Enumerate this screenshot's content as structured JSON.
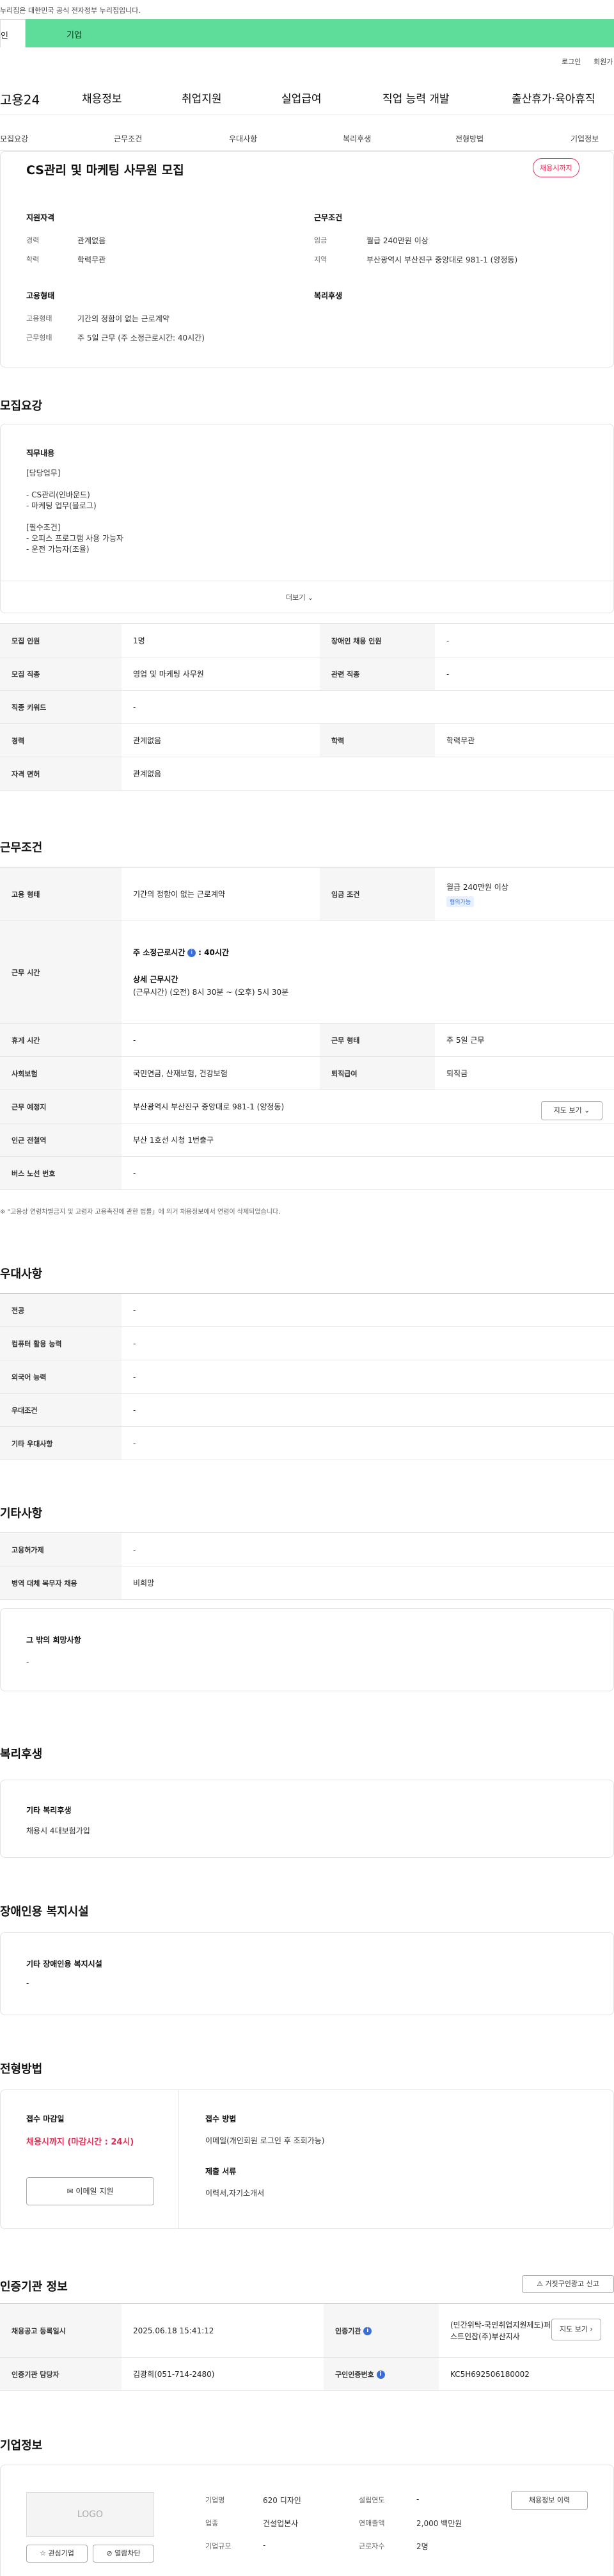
{
  "gov_banner": "누리집은 대한민국 공식 전자정부 누리집입니다.",
  "user_tabs": [
    "인",
    "기업"
  ],
  "top_links": [
    "로그인",
    "회원가"
  ],
  "nav": {
    "logo": "고용24",
    "items": [
      "채용정보",
      "취업지원",
      "실업급여",
      "직업 능력 개발",
      "출산휴가·육아휴직"
    ]
  },
  "subnav": [
    "모집요강",
    "근무조건",
    "우대사항",
    "복리후생",
    "전형방법",
    "기업정보"
  ],
  "summary": {
    "title": "CS관리 및 마케팅 사무원 모집",
    "status": "채용시까지",
    "qual_head": "지원자격",
    "career_l": "경력",
    "career_v": "관계없음",
    "edu_l": "학력",
    "edu_v": "학력무관",
    "cond_head": "근무조건",
    "wage_l": "임금",
    "wage_v": "월급 240만원 이상",
    "loc_l": "지역",
    "loc_v": "부산광역시 부산진구 중앙대로 981-1 (양정동)",
    "emp_head": "고용형태",
    "emp_type_l": "고용형태",
    "emp_type_v": "기간의 정함이 없는 근로계약",
    "work_l": "근무형태",
    "work_v": "주 5일 근무 (주 소정근로시간: 40시간)",
    "welfare_head": "복리후생"
  },
  "recruit": {
    "heading": "모집요강",
    "duty_head": "직무내용",
    "duty_lines": [
      "[담당업무]",
      "",
      "- CS관리(인바운드)",
      "- 마케팅 업무(블로그)",
      "",
      "[필수조건]",
      "- 오피스 프로그램 사용 가능자",
      "- 운전 가능자(조율)"
    ],
    "more": "더보기",
    "rows": [
      [
        "모집 인원",
        "1명",
        "장애인 채용 인원",
        "-"
      ],
      [
        "모집 직종",
        "영업 및 마케팅 사무원",
        "관련 직종",
        "-"
      ],
      [
        "직종 키워드",
        "-"
      ],
      [
        "경력",
        "관계없음",
        "학력",
        "학력무관"
      ],
      [
        "자격 면허",
        "관계없음"
      ]
    ]
  },
  "conditions": {
    "heading": "근무조건",
    "emp_l": "고용 형태",
    "emp_v": "기간의 정함이 없는 근로계약",
    "wage_l": "임금 조건",
    "wage_v": "월급 240만원 이상",
    "wage_badge": "협의가능",
    "hours_l": "근무 시간",
    "hours_a": "주 소정근로시간",
    "hours_b": ": 40시간",
    "hours_detail_h": "상세 근무시간",
    "hours_detail": "(근무시간) (오전) 8시 30분 ~ (오후) 5시 30분",
    "rest_l": "휴게 시간",
    "rest_v": "-",
    "form_l": "근무 형태",
    "form_v": "주 5일 근무",
    "ins_l": "사회보험",
    "ins_v": "국민연금, 산재보험, 건강보험",
    "ret_l": "퇴직급여",
    "ret_v": "퇴직금",
    "place_l": "근무 예정지",
    "place_v": "부산광역시 부산진구 중앙대로 981-1 (양정동)",
    "map_btn": "지도 보기",
    "subway_l": "인근 전철역",
    "subway_v": "부산 1호선 시청 1번출구",
    "bus_l": "버스 노선 번호",
    "bus_v": "-",
    "note": "\"고용상 연령차별금지 및 고령자 고용촉진에 관한 법률」에 의거 채용정보에서 연령이 삭제되었습니다."
  },
  "pref": {
    "heading": "우대사항",
    "rows": [
      [
        "전공",
        "-"
      ],
      [
        "컴퓨터 활용 능력",
        "-"
      ],
      [
        "외국어 능력",
        "-"
      ],
      [
        "우대조건",
        "-"
      ],
      [
        "기타 우대사항",
        "-"
      ]
    ]
  },
  "etc": {
    "heading": "기타사항",
    "rows": [
      [
        "고용허가제",
        "-"
      ],
      [
        "병역 대체 복무자 채용",
        "비희망"
      ]
    ],
    "other_head": "그 밖의 희망사항",
    "other_v": "-"
  },
  "welfare": {
    "heading": "복리후생",
    "head": "기타 복리후생",
    "value": "채용시 4대보험가입"
  },
  "disabled": {
    "heading": "장애인용 복지시설",
    "head": "기타 장애인용 복지시설",
    "value": "-"
  },
  "process": {
    "heading": "전형방법",
    "deadline_l": "접수 마감일",
    "deadline_v": "채용시까지 (마감시간 : 24시)",
    "method_l": "접수 방법",
    "method_v": "이메일(개인회원 로그인 후 조회가능)",
    "docs_l": "제출 서류",
    "docs_v": "이력서,자기소개서",
    "email_btn": "이메일 지원"
  },
  "agency": {
    "heading": "인증기관 정보",
    "report_btn": "거짓구인광고 신고",
    "reg_l": "채용공고 등록일시",
    "reg_v": "2025.06.18 15:41:12",
    "org_l": "인증기관",
    "org_v": "(민간위탁-국민취업지원제도)퍼스트인잡(주)부산지사",
    "map_btn": "지도 보기",
    "mgr_l": "인증기관 담당자",
    "mgr_v": "김광희(051-714-2480)",
    "num_l": "구인인증번호",
    "num_v": "KC5H692506180002"
  },
  "company": {
    "heading": "기업정보",
    "logo": "LOGO",
    "fav": "관심기업",
    "block": "열람차단",
    "name_l": "기업명",
    "name_v": "620 디자인",
    "year_l": "설립연도",
    "year_v": "-",
    "ind_l": "업종",
    "ind_v": "건설업본사",
    "sales_l": "연매출액",
    "sales_v": "2,000 백만원",
    "size_l": "기업규모",
    "size_v": "-",
    "emp_l": "근로자수",
    "emp_v": "2명",
    "hist_btn": "채용정보 이력"
  }
}
